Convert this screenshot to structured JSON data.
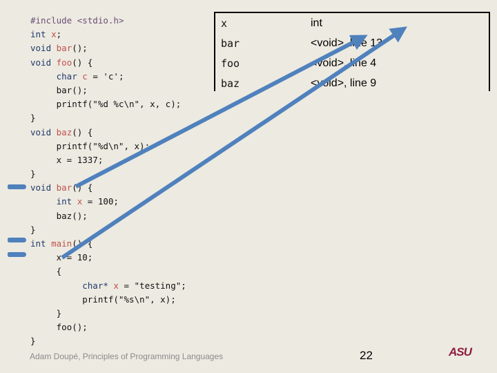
{
  "code_lines": [
    [
      {
        "t": "#include ",
        "c": "pp"
      },
      {
        "t": "<stdio.h>",
        "c": "pp"
      }
    ],
    [
      {
        "t": "int ",
        "c": "kw"
      },
      {
        "t": "x",
        "c": "id"
      },
      {
        "t": ";",
        "c": ""
      }
    ],
    [
      {
        "t": "void ",
        "c": "kw"
      },
      {
        "t": "bar",
        "c": "id"
      },
      {
        "t": "();",
        "c": ""
      }
    ],
    [
      {
        "t": "void ",
        "c": "kw"
      },
      {
        "t": "foo",
        "c": "id"
      },
      {
        "t": "() {",
        "c": ""
      }
    ],
    [
      {
        "t": "     char ",
        "c": "kw"
      },
      {
        "t": "c",
        "c": "id"
      },
      {
        "t": " = 'c';",
        "c": ""
      }
    ],
    [
      {
        "t": "     bar();",
        "c": ""
      }
    ],
    [
      {
        "t": "     printf(\"%d %c\\n\", x, c);",
        "c": ""
      }
    ],
    [
      {
        "t": "}",
        "c": ""
      }
    ],
    [
      {
        "t": "void ",
        "c": "kw"
      },
      {
        "t": "baz",
        "c": "id"
      },
      {
        "t": "() {",
        "c": ""
      }
    ],
    [
      {
        "t": "     printf(\"%d\\n\", x);",
        "c": ""
      }
    ],
    [
      {
        "t": "     x = 1337;",
        "c": ""
      }
    ],
    [
      {
        "t": "}",
        "c": ""
      }
    ],
    [
      {
        "t": "void ",
        "c": "kw"
      },
      {
        "t": "bar",
        "c": "id"
      },
      {
        "t": "() {",
        "c": ""
      }
    ],
    [
      {
        "t": "     int ",
        "c": "kw"
      },
      {
        "t": "x",
        "c": "id"
      },
      {
        "t": " = 100;",
        "c": ""
      }
    ],
    [
      {
        "t": "     baz();",
        "c": ""
      }
    ],
    [
      {
        "t": "}",
        "c": ""
      }
    ],
    [
      {
        "t": "int ",
        "c": "kw"
      },
      {
        "t": "main",
        "c": "id"
      },
      {
        "t": "() {",
        "c": ""
      }
    ],
    [
      {
        "t": "     x = 10;",
        "c": ""
      }
    ],
    [
      {
        "t": "     {",
        "c": ""
      }
    ],
    [
      {
        "t": "          char* ",
        "c": "kw"
      },
      {
        "t": "x",
        "c": "id"
      },
      {
        "t": " = \"testing\";",
        "c": ""
      }
    ],
    [
      {
        "t": "          printf(\"%s\\n\", x);",
        "c": ""
      }
    ],
    [
      {
        "t": "     }",
        "c": ""
      }
    ],
    [
      {
        "t": "     foo();",
        "c": ""
      }
    ],
    [
      {
        "t": "}",
        "c": ""
      }
    ]
  ],
  "symbol_table": [
    {
      "name": "x",
      "type": "int"
    },
    {
      "name": "bar",
      "type": "<void>, line 13"
    },
    {
      "name": "foo",
      "type": "<void>, line 4"
    },
    {
      "name": "baz",
      "type": "<void>, line 9"
    }
  ],
  "footer": "Adam Doupé, Principles of Programming Languages",
  "page_number": "22",
  "logo": {
    "text_a": "AS",
    "text_b": "U"
  },
  "colors": {
    "arrow": "#4f81bd",
    "keyword": "#1f3a6b",
    "identifier": "#c0504d",
    "logo": "#8c1d40"
  }
}
